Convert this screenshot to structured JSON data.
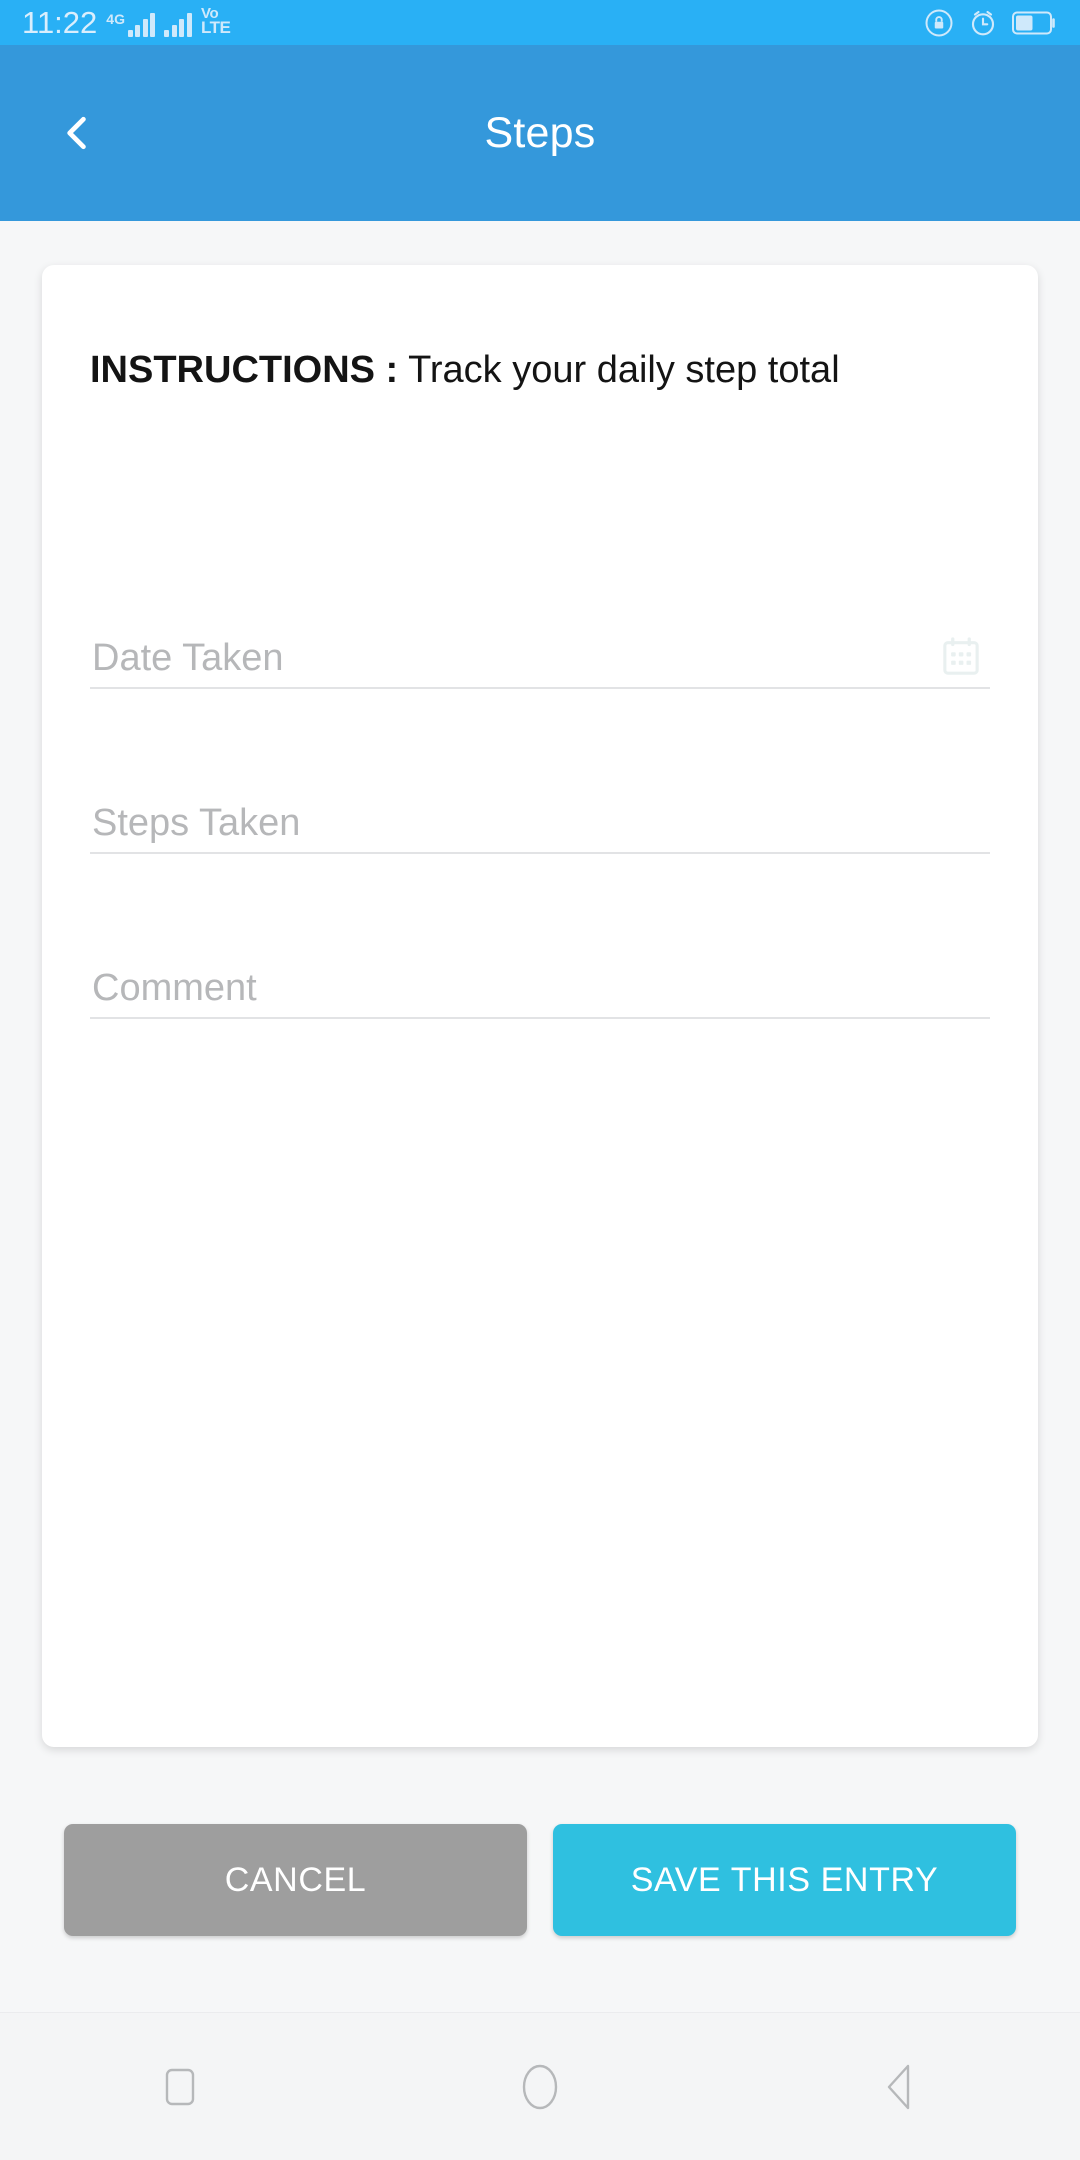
{
  "status_bar": {
    "time": "11:22",
    "network_label": "4G",
    "volte_top": "Vo",
    "volte_bottom": "LTE",
    "icons": [
      "rotation-lock-icon",
      "alarm-icon",
      "battery-icon"
    ],
    "background_color": "#29b0f5",
    "foreground_color": "#cfe9fb"
  },
  "app_bar": {
    "title": "Steps",
    "back_label": "Back",
    "background_color": "#3498db",
    "title_color": "#ffffff"
  },
  "card": {
    "instructions_label": "INSTRUCTIONS :",
    "instructions_text": " Track your daily step total",
    "fields": [
      {
        "name": "date-taken",
        "placeholder": "Date Taken",
        "value": "",
        "icon": "calendar-icon"
      },
      {
        "name": "steps-taken",
        "placeholder": "Steps Taken",
        "value": "",
        "icon": ""
      },
      {
        "name": "comment",
        "placeholder": "Comment",
        "value": "",
        "icon": ""
      }
    ]
  },
  "actions": {
    "cancel_label": "CANCEL",
    "save_label": "SAVE THIS ENTRY",
    "cancel_color": "#9e9e9e",
    "save_color": "#2fc0e0"
  },
  "nav_bar": {
    "items": [
      {
        "name": "recents-button",
        "icon": "square-icon"
      },
      {
        "name": "home-button",
        "icon": "circle-icon"
      },
      {
        "name": "back-button",
        "icon": "triangle-left-icon"
      }
    ],
    "icon_color": "#b6b8ba"
  }
}
